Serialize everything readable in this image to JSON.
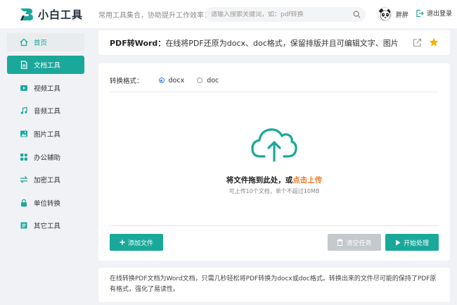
{
  "header": {
    "logo_text": "小白工具",
    "slogan": "常用工具集合，协助提升工作效率！",
    "search_placeholder": "请输入搜索关键词，如：pdf转换",
    "username": "胖胖",
    "logout_label": "退出登录"
  },
  "sidebar": {
    "items": [
      {
        "label": "首页",
        "icon": "home-icon"
      },
      {
        "label": "文档工具",
        "icon": "document-icon"
      },
      {
        "label": "视频工具",
        "icon": "video-icon"
      },
      {
        "label": "音频工具",
        "icon": "music-icon"
      },
      {
        "label": "图片工具",
        "icon": "image-icon"
      },
      {
        "label": "办公辅助",
        "icon": "grid-icon"
      },
      {
        "label": "加密工具",
        "icon": "swap-icon"
      },
      {
        "label": "单位转换",
        "icon": "lock-icon"
      },
      {
        "label": "其它工具",
        "icon": "list-icon"
      }
    ]
  },
  "tool": {
    "title_bold": "PDF转Word：",
    "title_desc": "在线将PDF还原为docx、doc格式，保留排版并且可编辑文字、图片"
  },
  "upload": {
    "format_label": "转换格式：",
    "options": [
      {
        "label": "docx",
        "selected": true
      },
      {
        "label": "doc",
        "selected": false
      }
    ],
    "drop_text": "将文件拖到此处，或",
    "drop_link": "点击上传",
    "limit_text": "可上传10个文档，单个不超过10MB",
    "add_button": "添加文件",
    "clear_button": "清空任务",
    "start_button": "开始处理"
  },
  "description": "在线转换PDF文档为Word文档，只需几秒轻松将PDF转换为docx或doc格式。转换出来的文件尽可能的保持了PDF原有格式，强化了易读性。",
  "colors": {
    "accent": "#1aa89a",
    "link": "#f07a28",
    "disabled": "#c4c9cc",
    "star": "#f5b400"
  }
}
